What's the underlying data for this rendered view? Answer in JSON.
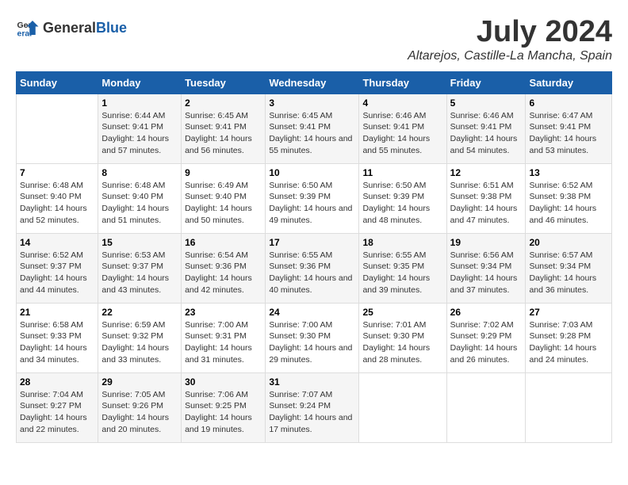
{
  "header": {
    "logo_general": "General",
    "logo_blue": "Blue",
    "month_year": "July 2024",
    "location": "Altarejos, Castille-La Mancha, Spain"
  },
  "weekdays": [
    "Sunday",
    "Monday",
    "Tuesday",
    "Wednesday",
    "Thursday",
    "Friday",
    "Saturday"
  ],
  "weeks": [
    [
      {
        "day": "",
        "sunrise": "",
        "sunset": "",
        "daylight": ""
      },
      {
        "day": "1",
        "sunrise": "Sunrise: 6:44 AM",
        "sunset": "Sunset: 9:41 PM",
        "daylight": "Daylight: 14 hours and 57 minutes."
      },
      {
        "day": "2",
        "sunrise": "Sunrise: 6:45 AM",
        "sunset": "Sunset: 9:41 PM",
        "daylight": "Daylight: 14 hours and 56 minutes."
      },
      {
        "day": "3",
        "sunrise": "Sunrise: 6:45 AM",
        "sunset": "Sunset: 9:41 PM",
        "daylight": "Daylight: 14 hours and 55 minutes."
      },
      {
        "day": "4",
        "sunrise": "Sunrise: 6:46 AM",
        "sunset": "Sunset: 9:41 PM",
        "daylight": "Daylight: 14 hours and 55 minutes."
      },
      {
        "day": "5",
        "sunrise": "Sunrise: 6:46 AM",
        "sunset": "Sunset: 9:41 PM",
        "daylight": "Daylight: 14 hours and 54 minutes."
      },
      {
        "day": "6",
        "sunrise": "Sunrise: 6:47 AM",
        "sunset": "Sunset: 9:41 PM",
        "daylight": "Daylight: 14 hours and 53 minutes."
      }
    ],
    [
      {
        "day": "7",
        "sunrise": "Sunrise: 6:48 AM",
        "sunset": "Sunset: 9:40 PM",
        "daylight": "Daylight: 14 hours and 52 minutes."
      },
      {
        "day": "8",
        "sunrise": "Sunrise: 6:48 AM",
        "sunset": "Sunset: 9:40 PM",
        "daylight": "Daylight: 14 hours and 51 minutes."
      },
      {
        "day": "9",
        "sunrise": "Sunrise: 6:49 AM",
        "sunset": "Sunset: 9:40 PM",
        "daylight": "Daylight: 14 hours and 50 minutes."
      },
      {
        "day": "10",
        "sunrise": "Sunrise: 6:50 AM",
        "sunset": "Sunset: 9:39 PM",
        "daylight": "Daylight: 14 hours and 49 minutes."
      },
      {
        "day": "11",
        "sunrise": "Sunrise: 6:50 AM",
        "sunset": "Sunset: 9:39 PM",
        "daylight": "Daylight: 14 hours and 48 minutes."
      },
      {
        "day": "12",
        "sunrise": "Sunrise: 6:51 AM",
        "sunset": "Sunset: 9:38 PM",
        "daylight": "Daylight: 14 hours and 47 minutes."
      },
      {
        "day": "13",
        "sunrise": "Sunrise: 6:52 AM",
        "sunset": "Sunset: 9:38 PM",
        "daylight": "Daylight: 14 hours and 46 minutes."
      }
    ],
    [
      {
        "day": "14",
        "sunrise": "Sunrise: 6:52 AM",
        "sunset": "Sunset: 9:37 PM",
        "daylight": "Daylight: 14 hours and 44 minutes."
      },
      {
        "day": "15",
        "sunrise": "Sunrise: 6:53 AM",
        "sunset": "Sunset: 9:37 PM",
        "daylight": "Daylight: 14 hours and 43 minutes."
      },
      {
        "day": "16",
        "sunrise": "Sunrise: 6:54 AM",
        "sunset": "Sunset: 9:36 PM",
        "daylight": "Daylight: 14 hours and 42 minutes."
      },
      {
        "day": "17",
        "sunrise": "Sunrise: 6:55 AM",
        "sunset": "Sunset: 9:36 PM",
        "daylight": "Daylight: 14 hours and 40 minutes."
      },
      {
        "day": "18",
        "sunrise": "Sunrise: 6:55 AM",
        "sunset": "Sunset: 9:35 PM",
        "daylight": "Daylight: 14 hours and 39 minutes."
      },
      {
        "day": "19",
        "sunrise": "Sunrise: 6:56 AM",
        "sunset": "Sunset: 9:34 PM",
        "daylight": "Daylight: 14 hours and 37 minutes."
      },
      {
        "day": "20",
        "sunrise": "Sunrise: 6:57 AM",
        "sunset": "Sunset: 9:34 PM",
        "daylight": "Daylight: 14 hours and 36 minutes."
      }
    ],
    [
      {
        "day": "21",
        "sunrise": "Sunrise: 6:58 AM",
        "sunset": "Sunset: 9:33 PM",
        "daylight": "Daylight: 14 hours and 34 minutes."
      },
      {
        "day": "22",
        "sunrise": "Sunrise: 6:59 AM",
        "sunset": "Sunset: 9:32 PM",
        "daylight": "Daylight: 14 hours and 33 minutes."
      },
      {
        "day": "23",
        "sunrise": "Sunrise: 7:00 AM",
        "sunset": "Sunset: 9:31 PM",
        "daylight": "Daylight: 14 hours and 31 minutes."
      },
      {
        "day": "24",
        "sunrise": "Sunrise: 7:00 AM",
        "sunset": "Sunset: 9:30 PM",
        "daylight": "Daylight: 14 hours and 29 minutes."
      },
      {
        "day": "25",
        "sunrise": "Sunrise: 7:01 AM",
        "sunset": "Sunset: 9:30 PM",
        "daylight": "Daylight: 14 hours and 28 minutes."
      },
      {
        "day": "26",
        "sunrise": "Sunrise: 7:02 AM",
        "sunset": "Sunset: 9:29 PM",
        "daylight": "Daylight: 14 hours and 26 minutes."
      },
      {
        "day": "27",
        "sunrise": "Sunrise: 7:03 AM",
        "sunset": "Sunset: 9:28 PM",
        "daylight": "Daylight: 14 hours and 24 minutes."
      }
    ],
    [
      {
        "day": "28",
        "sunrise": "Sunrise: 7:04 AM",
        "sunset": "Sunset: 9:27 PM",
        "daylight": "Daylight: 14 hours and 22 minutes."
      },
      {
        "day": "29",
        "sunrise": "Sunrise: 7:05 AM",
        "sunset": "Sunset: 9:26 PM",
        "daylight": "Daylight: 14 hours and 20 minutes."
      },
      {
        "day": "30",
        "sunrise": "Sunrise: 7:06 AM",
        "sunset": "Sunset: 9:25 PM",
        "daylight": "Daylight: 14 hours and 19 minutes."
      },
      {
        "day": "31",
        "sunrise": "Sunrise: 7:07 AM",
        "sunset": "Sunset: 9:24 PM",
        "daylight": "Daylight: 14 hours and 17 minutes."
      },
      {
        "day": "",
        "sunrise": "",
        "sunset": "",
        "daylight": ""
      },
      {
        "day": "",
        "sunrise": "",
        "sunset": "",
        "daylight": ""
      },
      {
        "day": "",
        "sunrise": "",
        "sunset": "",
        "daylight": ""
      }
    ]
  ]
}
